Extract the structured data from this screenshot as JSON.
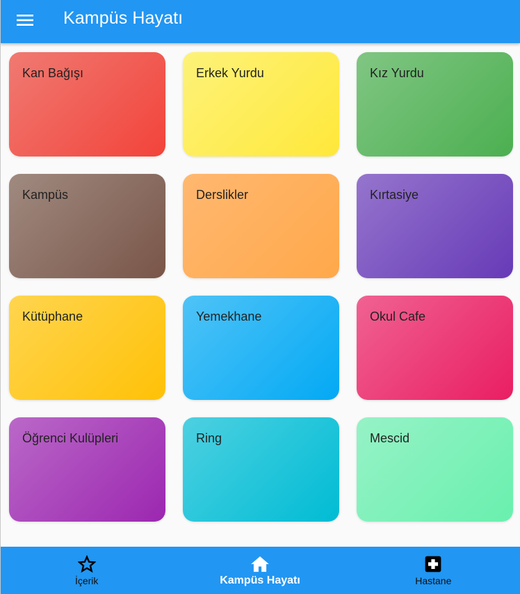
{
  "appbar": {
    "title": "Kampüs Hayatı",
    "menu_icon": "menu-icon",
    "color": "#2196f3"
  },
  "tiles": [
    {
      "label": "Kan Bağışı",
      "from": "#f07a72",
      "to": "#f2433a"
    },
    {
      "label": "Erkek Yurdu",
      "from": "#fdf279",
      "to": "#ffe83a"
    },
    {
      "label": "Kız Yurdu",
      "from": "#80c683",
      "to": "#4caf50"
    },
    {
      "label": "Kampüs",
      "from": "#a08a80",
      "to": "#795548"
    },
    {
      "label": "Derslikler",
      "from": "#ffb870",
      "to": "#ffa84a"
    },
    {
      "label": "Kırtasiye",
      "from": "#9575cd",
      "to": "#673ab7"
    },
    {
      "label": "Kütüphane",
      "from": "#ffd54f",
      "to": "#ffc107"
    },
    {
      "label": "Yemekhane",
      "from": "#4fc3f7",
      "to": "#03a9f4"
    },
    {
      "label": "Okul Cafe",
      "from": "#f06292",
      "to": "#e91e63"
    },
    {
      "label": "Öğrenci Kulüpleri",
      "from": "#ba68c8",
      "to": "#9c27b0"
    },
    {
      "label": "Ring",
      "from": "#4dd0e1",
      "to": "#00bcd4"
    },
    {
      "label": "Mescid",
      "from": "#96f2c6",
      "to": "#69f0ae"
    }
  ],
  "bottom_nav": {
    "items": [
      {
        "label": "İçerik",
        "icon": "star-outline-icon",
        "active": false
      },
      {
        "label": "Kampüs Hayatı",
        "icon": "home-icon",
        "active": true
      },
      {
        "label": "Hastane",
        "icon": "hospital-icon",
        "active": false
      }
    ]
  }
}
